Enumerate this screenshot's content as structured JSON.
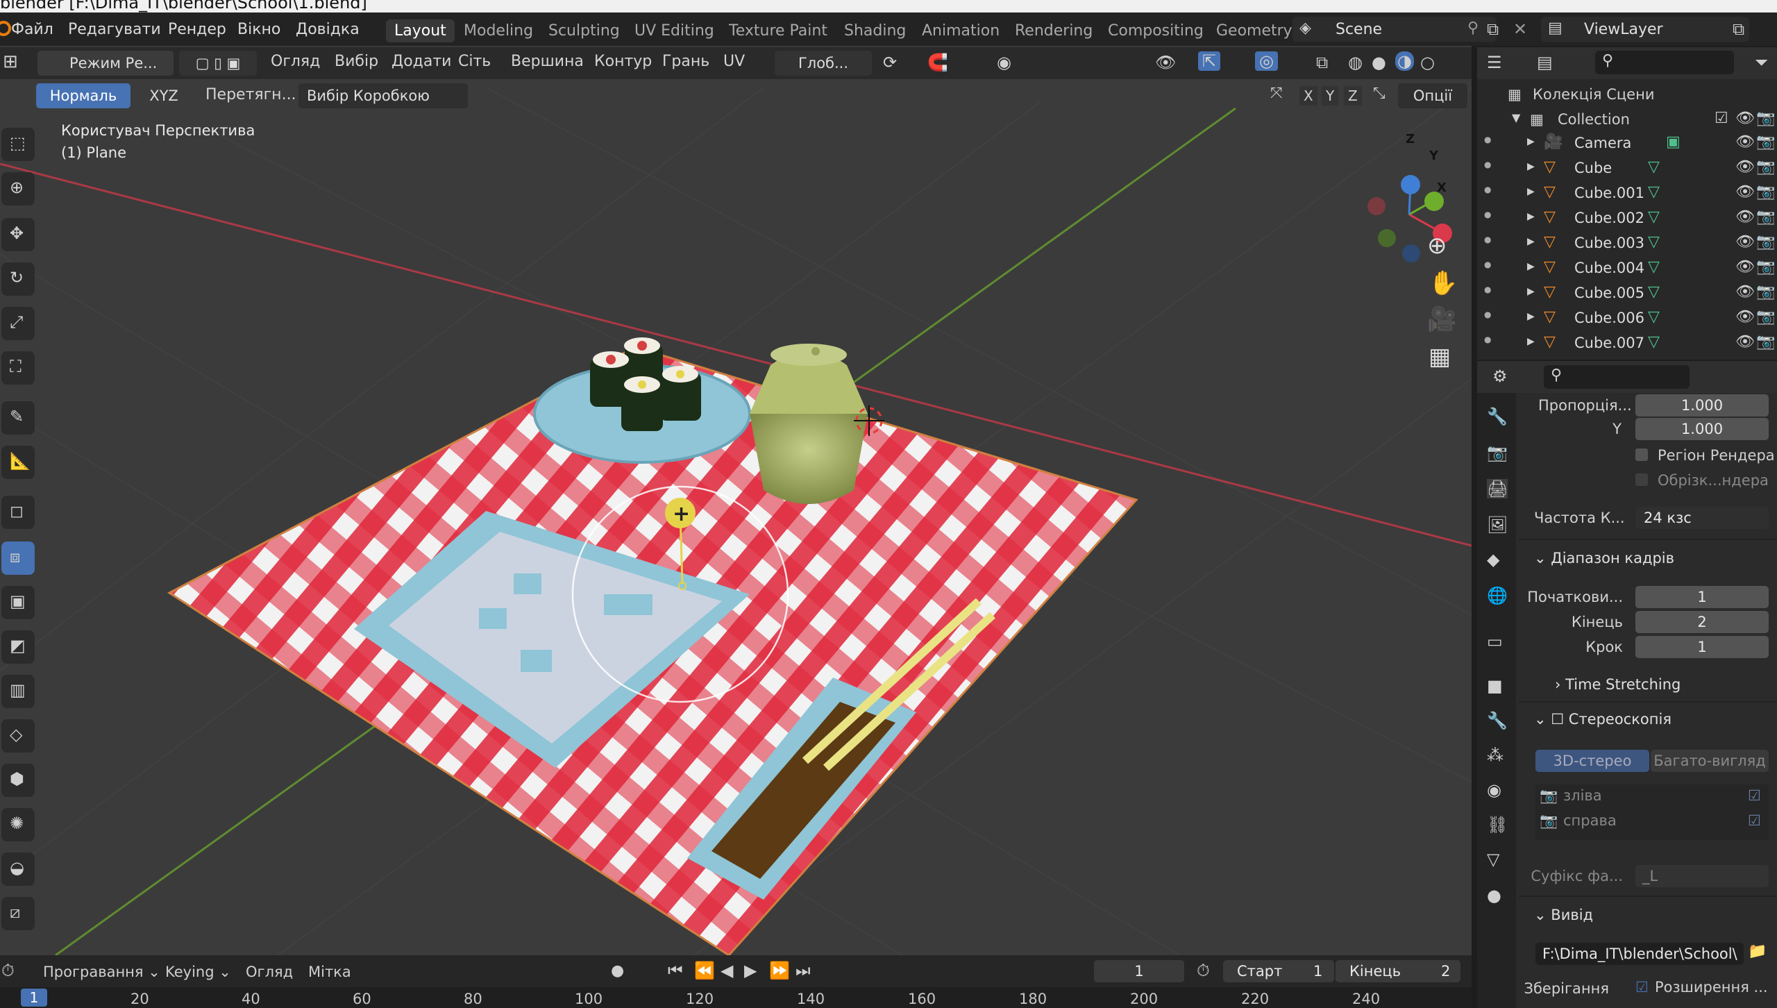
{
  "window": {
    "title": "blender [F:\\Dima_IT\\blender\\School\\1.blend]"
  },
  "menu": [
    "Файл",
    "Редагувати",
    "Рендер",
    "Вікно",
    "Довідка"
  ],
  "workspaces": [
    "Layout",
    "Modeling",
    "Sculpting",
    "UV Editing",
    "Texture Paint",
    "Shading",
    "Animation",
    "Rendering",
    "Compositing",
    "Geometry"
  ],
  "scene": {
    "name": "Scene",
    "view_layer": "ViewLayer"
  },
  "header": {
    "mode": "Режим Ре...",
    "items": [
      "Огляд",
      "Вибір",
      "Додати",
      "Сіть",
      "Вершина",
      "Контур",
      "Грань",
      "UV"
    ],
    "transform": "Глоб...",
    "orientation_active": "Нормаль",
    "orientation_other": "XYZ",
    "drag_label": "Перетягн...",
    "select_mode": "Вибір Коробкою",
    "axes": [
      "X",
      "Y",
      "Z"
    ],
    "options": "Опції"
  },
  "viewport": {
    "view_name": "Користувач Перспектива",
    "object_name": "(1) Plane"
  },
  "gizmo": {
    "x": "X",
    "y": "Y",
    "z": "Z"
  },
  "outliner": {
    "root": "Колекція Сцени",
    "collection": "Collection",
    "items": [
      "Camera",
      "Cube",
      "Cube.001",
      "Cube.002",
      "Cube.003",
      "Cube.004",
      "Cube.005",
      "Cube.006",
      "Cube.007"
    ]
  },
  "properties": {
    "aspect_label": "Пропорція...",
    "aspect_x": "1.000",
    "aspect_y_label": "Y",
    "aspect_y": "1.000",
    "render_region": "Регіон Рендера",
    "crop_region": "Обрізк...ндера",
    "fps_label": "Частота К...",
    "fps_value": "24 кзс",
    "frame_range_title": "Діапазон кадрів",
    "start_label": "Початкови...",
    "start_value": "1",
    "end_label": "Кінець",
    "end_value": "2",
    "step_label": "Крок",
    "step_value": "1",
    "time_stretching": "Time Stretching",
    "stereo_title": "Стереоскопія",
    "stereo_3d": "3D-стерео",
    "stereo_multi": "Багато-вигляд",
    "left_view": "зліва",
    "right_view": "справа",
    "suffix_label": "Суфікс фа...",
    "suffix_value": "_L",
    "output_title": "Вивід",
    "output_path": "F:\\Dima_IT\\blender\\School\\",
    "save_label": "Зберігання",
    "extensions_label": "Розширення ..."
  },
  "timeline": {
    "playback": "Програвання",
    "keying": "Keying",
    "view": "Огляд",
    "marker": "Мітка",
    "current_frame": "1",
    "start_label": "Старт",
    "start_value": "1",
    "end_label": "Кінець",
    "end_value": "2",
    "ruler_current": "1",
    "ticks": [
      "20",
      "40",
      "60",
      "80",
      "100",
      "120",
      "140",
      "160",
      "180",
      "200",
      "220",
      "240"
    ]
  },
  "colors": {
    "accent": "#4772b3",
    "tablecloth_red": "#e0263a",
    "tablecloth_white": "#f2f2f2",
    "plate": "#8fc5d6",
    "pot": "#a7b36b",
    "x_axis": "#d9394a",
    "y_axis": "#6fae2c"
  }
}
